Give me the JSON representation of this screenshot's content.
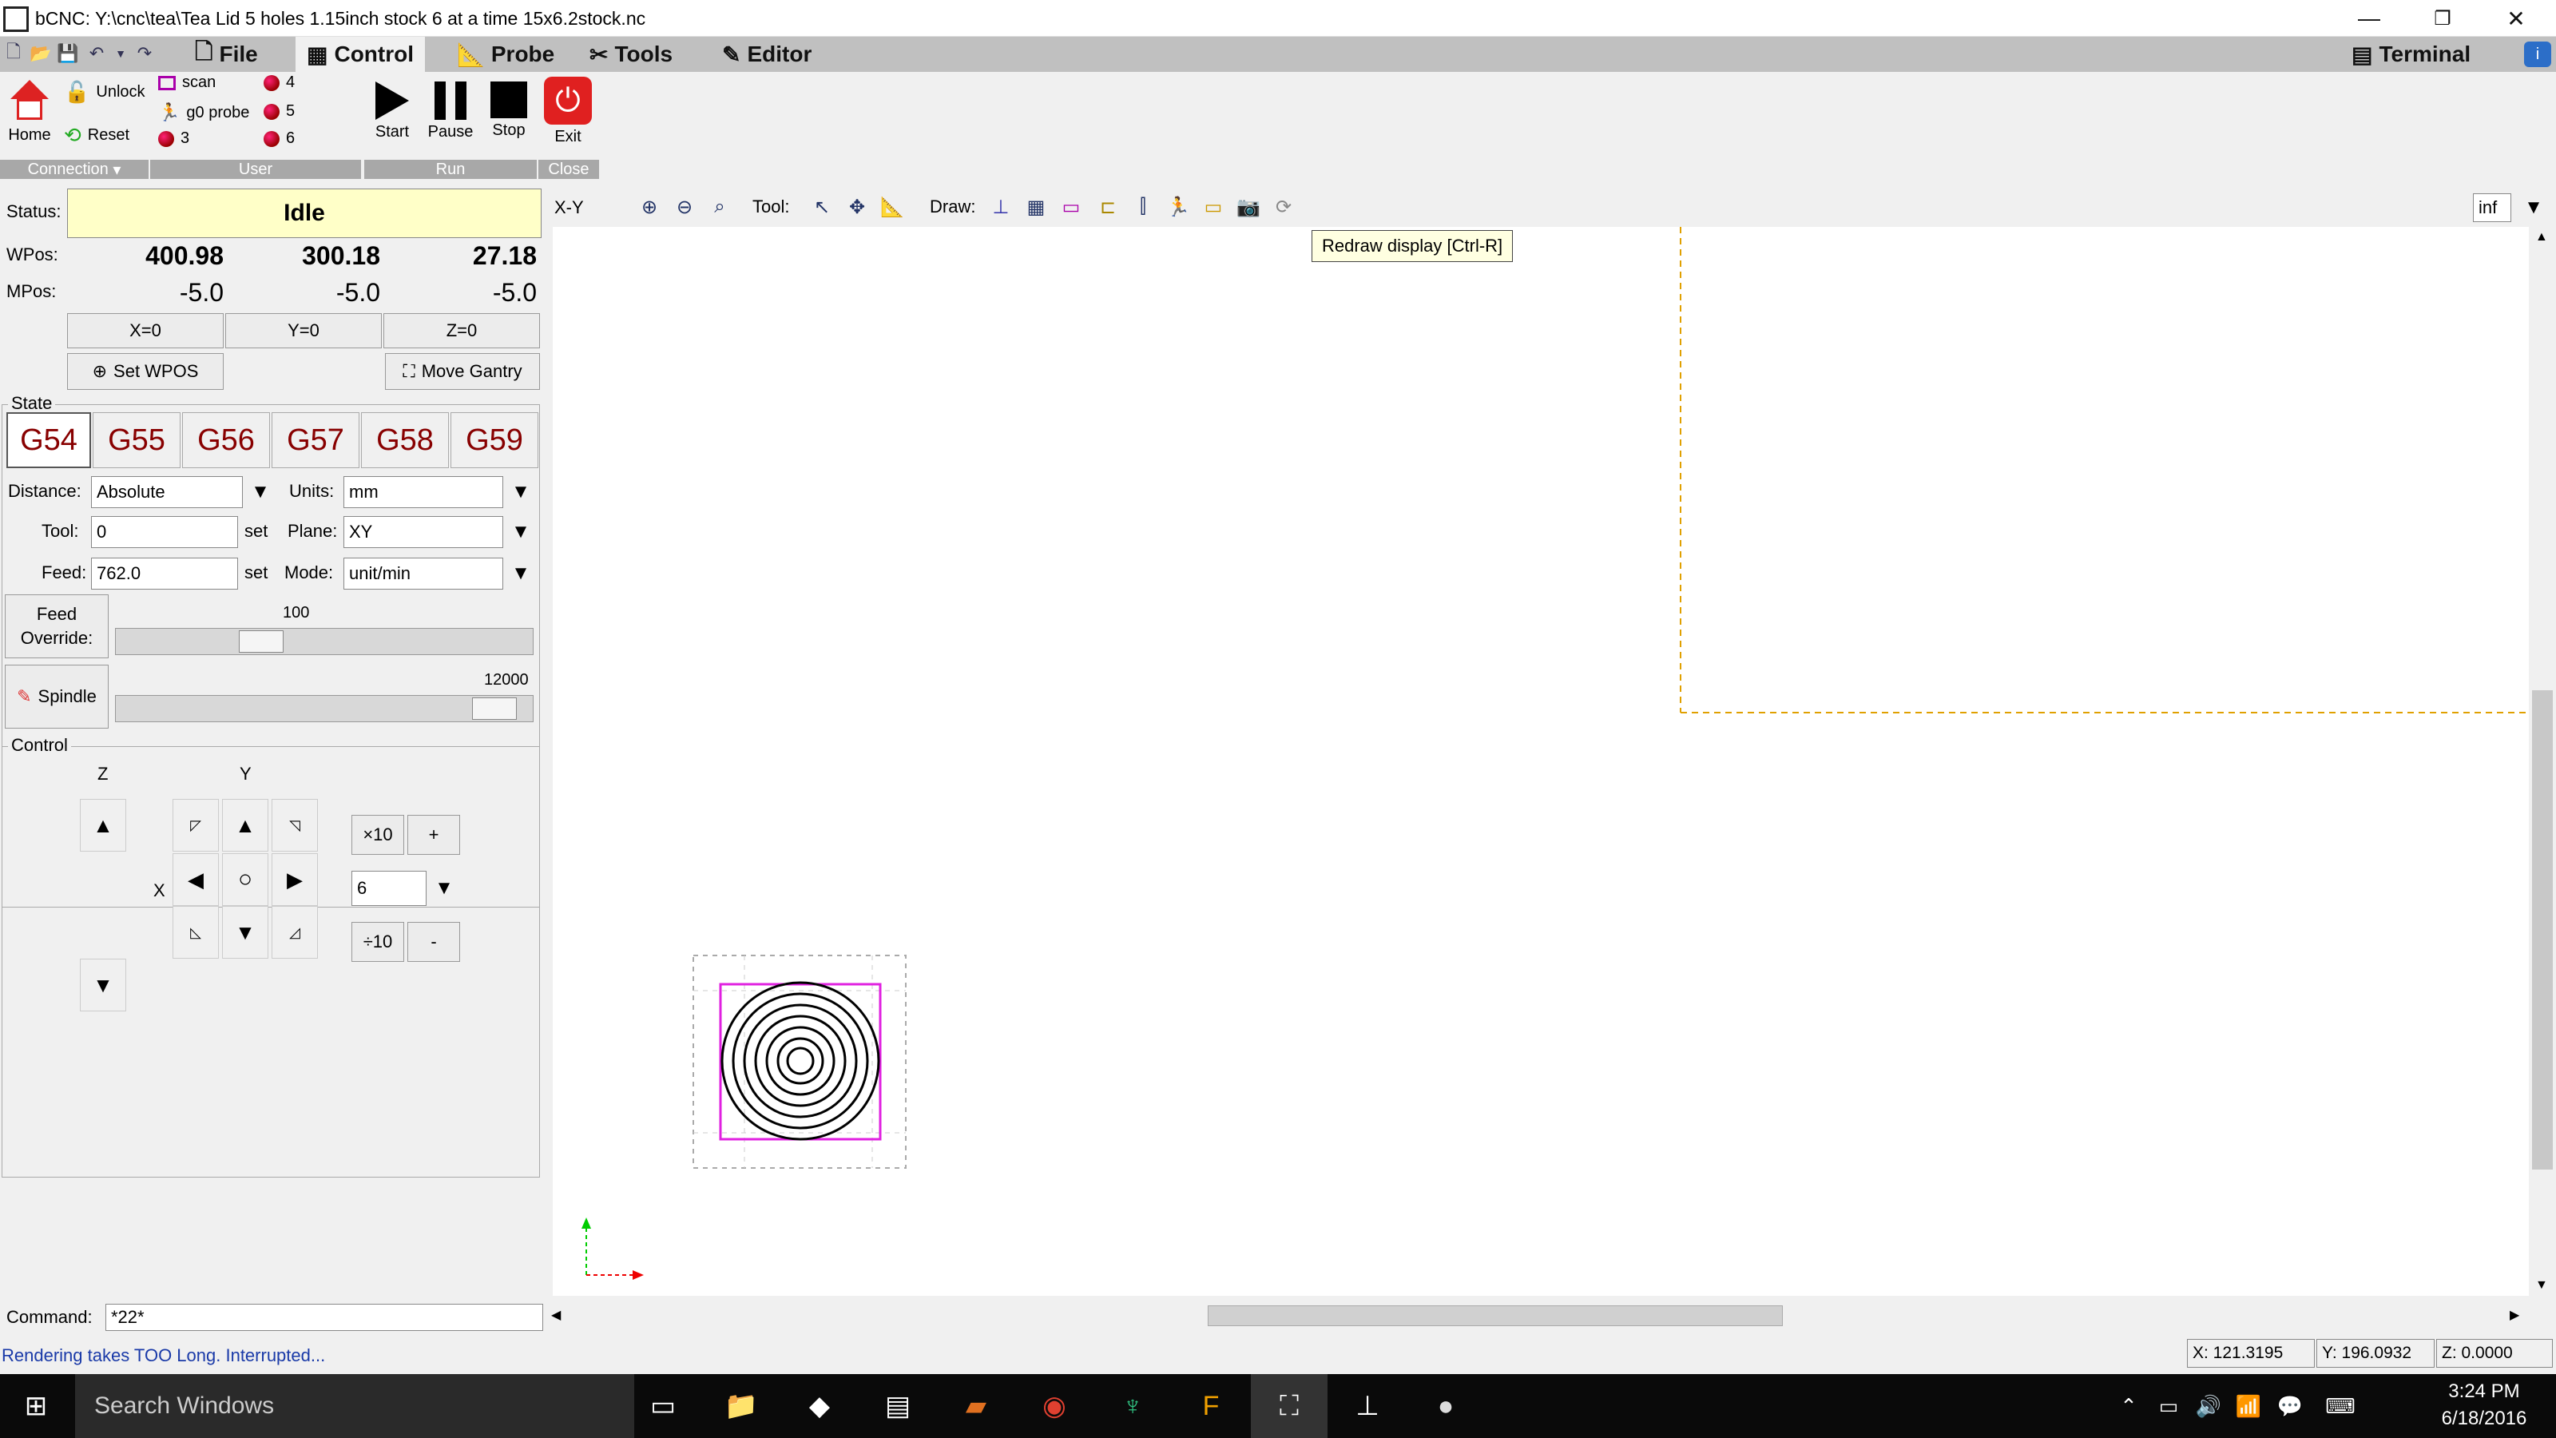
{
  "window": {
    "title": "bCNC: Y:\\cnc\\tea\\Tea Lid 5 holes 1.15inch stock 6 at a time 15x6.2stock.nc",
    "minimize": "—",
    "restore": "❐",
    "close": "✕"
  },
  "menu": {
    "file": "File",
    "control": "Control",
    "probe": "Probe",
    "tools": "Tools",
    "editor": "Editor",
    "terminal": "Terminal"
  },
  "ribbon": {
    "home": "Home",
    "unlock": "Unlock",
    "reset": "Reset",
    "connection": "Connection",
    "user_items": [
      "scan",
      "g0 probe",
      "3",
      "4",
      "5",
      "6"
    ],
    "user": "User",
    "start": "Start",
    "pause": "Pause",
    "stop": "Stop",
    "run": "Run",
    "exit": "Exit",
    "close": "Close"
  },
  "dro": {
    "status_label": "Status:",
    "status": "Idle",
    "wpos_label": "WPos:",
    "mpos_label": "MPos:",
    "wpos": [
      "400.98",
      "300.18",
      "27.18"
    ],
    "mpos": [
      "-5.0",
      "-5.0",
      "-5.0"
    ],
    "zero": [
      "X=0",
      "Y=0",
      "Z=0"
    ],
    "set_wpos": "Set WPOS",
    "move_gantry": "Move Gantry"
  },
  "state": {
    "legend": "State",
    "gcodes": [
      "G54",
      "G55",
      "G56",
      "G57",
      "G58",
      "G59"
    ],
    "distance_label": "Distance:",
    "distance": "Absolute",
    "units_label": "Units:",
    "units": "mm",
    "tool_label": "Tool:",
    "tool": "0",
    "plane_label": "Plane:",
    "plane": "XY",
    "feed_label": "Feed:",
    "feed": "762.0",
    "mode_label": "Mode:",
    "mode": "unit/min",
    "set": "set",
    "feed_override_label": "Feed\nOverride:",
    "feed_override": "100",
    "spindle_label": "Spindle",
    "spindle": "12000",
    "feed_override_fraction": 0.33,
    "spindle_fraction": 0.96
  },
  "control": {
    "legend": "Control",
    "z": "Z",
    "y": "Y",
    "x": "X",
    "x10": "×10",
    "plus": "+",
    "step": "6",
    "div10": "÷10",
    "minus": "-"
  },
  "canvas_toolbar": {
    "view": "X-Y",
    "tool_label": "Tool:",
    "draw_label": "Draw:",
    "tooltip": "Redraw display [Ctrl-R]",
    "zoom": "inf"
  },
  "command": {
    "label": "Command:",
    "value": "*22*"
  },
  "statusbar": {
    "message": "Rendering takes TOO Long. Interrupted...",
    "x": "X: 121.3195",
    "y": "Y: 196.0932",
    "z": "Z: 0.0000"
  },
  "taskbar": {
    "search": "Search Windows",
    "time": "3:24 PM",
    "date": "6/18/2016"
  }
}
